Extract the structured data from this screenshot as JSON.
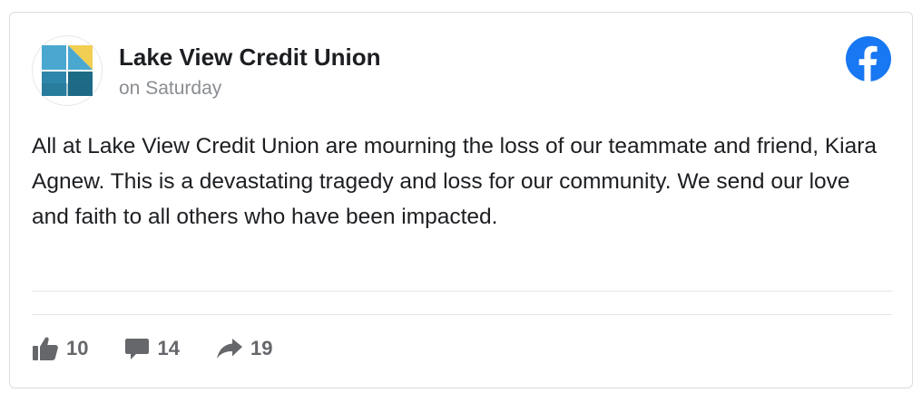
{
  "post": {
    "page_name": "Lake View Credit Union",
    "timestamp": "on Saturday",
    "body": "All at Lake View Credit Union are mourning the loss of our teammate and friend, Kiara Agnew. This is a devastating tragedy and loss for our community. We send our love and faith to all others who have been impacted.",
    "avatar_icon": "lake-view-credit-union-logo",
    "platform_icon": "facebook-icon"
  },
  "reactions": {
    "likes": "10",
    "comments": "14",
    "shares": "19"
  },
  "colors": {
    "facebook_blue": "#1877f2",
    "name_text": "#1c1e21",
    "meta_text": "#8a8d91",
    "action_icons": "#65676b",
    "logo_light_blue": "#4aa8d0",
    "logo_yellow": "#f2cf52",
    "logo_dark_teal": "#1e6b86"
  }
}
